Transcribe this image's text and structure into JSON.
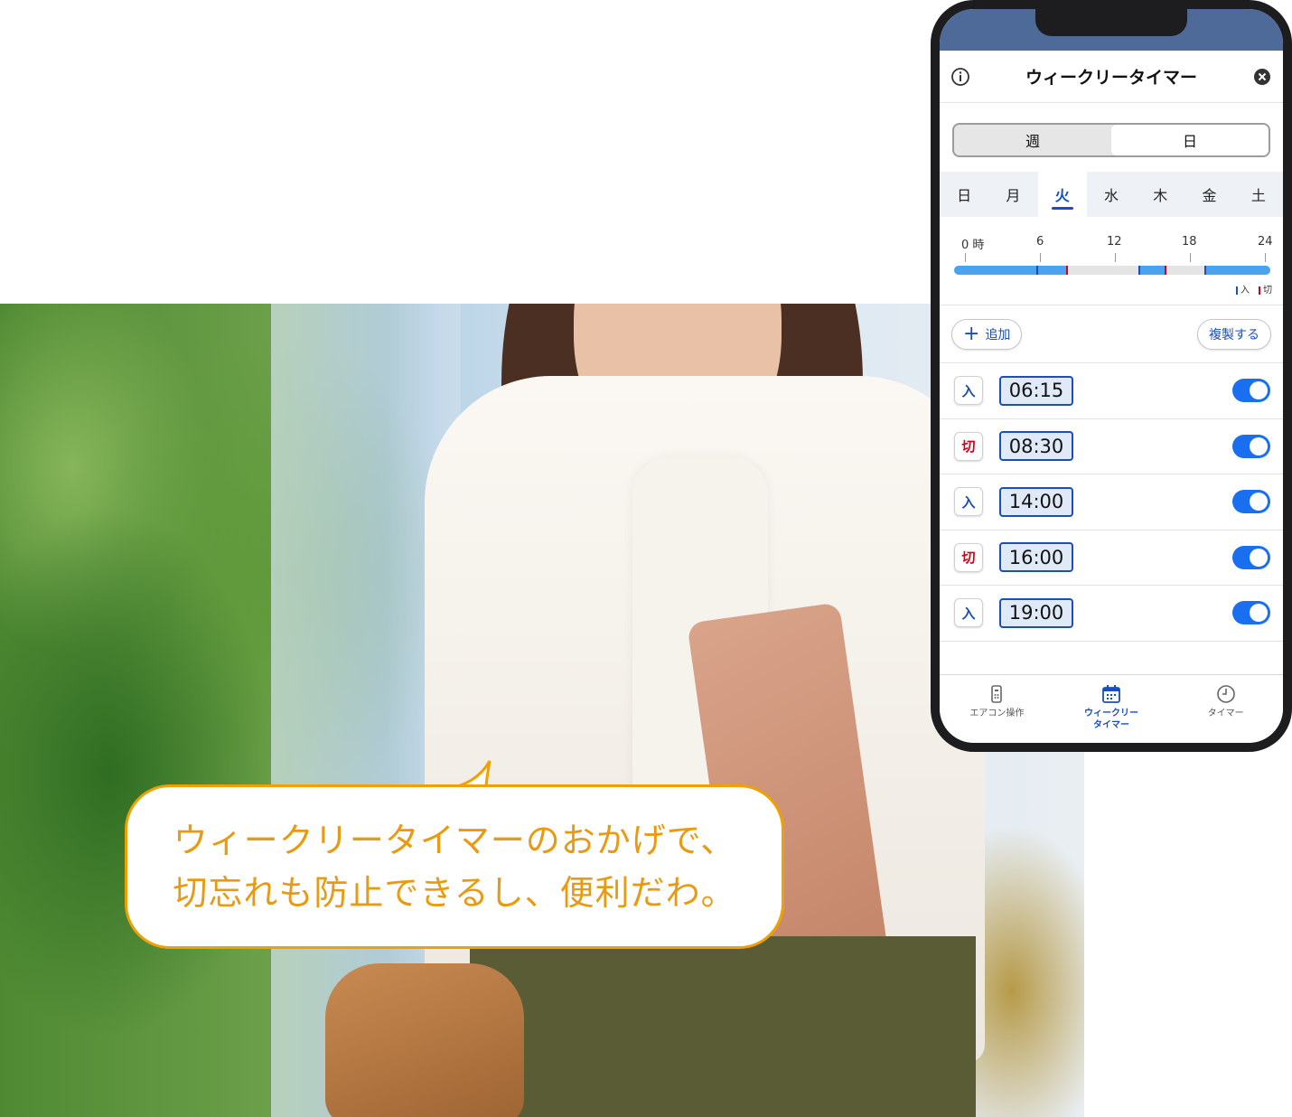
{
  "bubble": {
    "line1": "ウィークリータイマーのおかげで、",
    "line2": "切忘れも防止できるし、便利だわ。"
  },
  "app": {
    "title": "ウィークリータイマー",
    "info_icon": "info-icon",
    "close_icon": "close-icon",
    "segments": [
      {
        "label": "週",
        "active": false
      },
      {
        "label": "日",
        "active": true
      }
    ],
    "days": [
      "日",
      "月",
      "火",
      "水",
      "木",
      "金",
      "土"
    ],
    "selected_day": "火",
    "timeline": {
      "ticks": [
        "0 時",
        "6",
        "12",
        "18",
        "24"
      ],
      "legend_on": "入",
      "legend_off": "切"
    },
    "actions": {
      "add_label": "追加",
      "copy_label": "複製する"
    },
    "schedule": [
      {
        "type": "入",
        "kind": "on",
        "time": "06:15",
        "enabled": true
      },
      {
        "type": "切",
        "kind": "off",
        "time": "08:30",
        "enabled": true
      },
      {
        "type": "入",
        "kind": "on",
        "time": "14:00",
        "enabled": true
      },
      {
        "type": "切",
        "kind": "off",
        "time": "16:00",
        "enabled": true
      },
      {
        "type": "入",
        "kind": "on",
        "time": "19:00",
        "enabled": true
      }
    ],
    "tabs": [
      {
        "label": "エアコン操作",
        "icon": "remote-icon",
        "active": false
      },
      {
        "label": "ウィークリー\nタイマー",
        "icon": "calendar-icon",
        "active": true
      },
      {
        "label": "タイマー",
        "icon": "clock-icon",
        "active": false
      }
    ],
    "colors": {
      "accent": "#1a4fb8",
      "on_marker": "#1a4fb8",
      "off_marker": "#d0021b",
      "bubble_text": "#e89b12"
    }
  }
}
